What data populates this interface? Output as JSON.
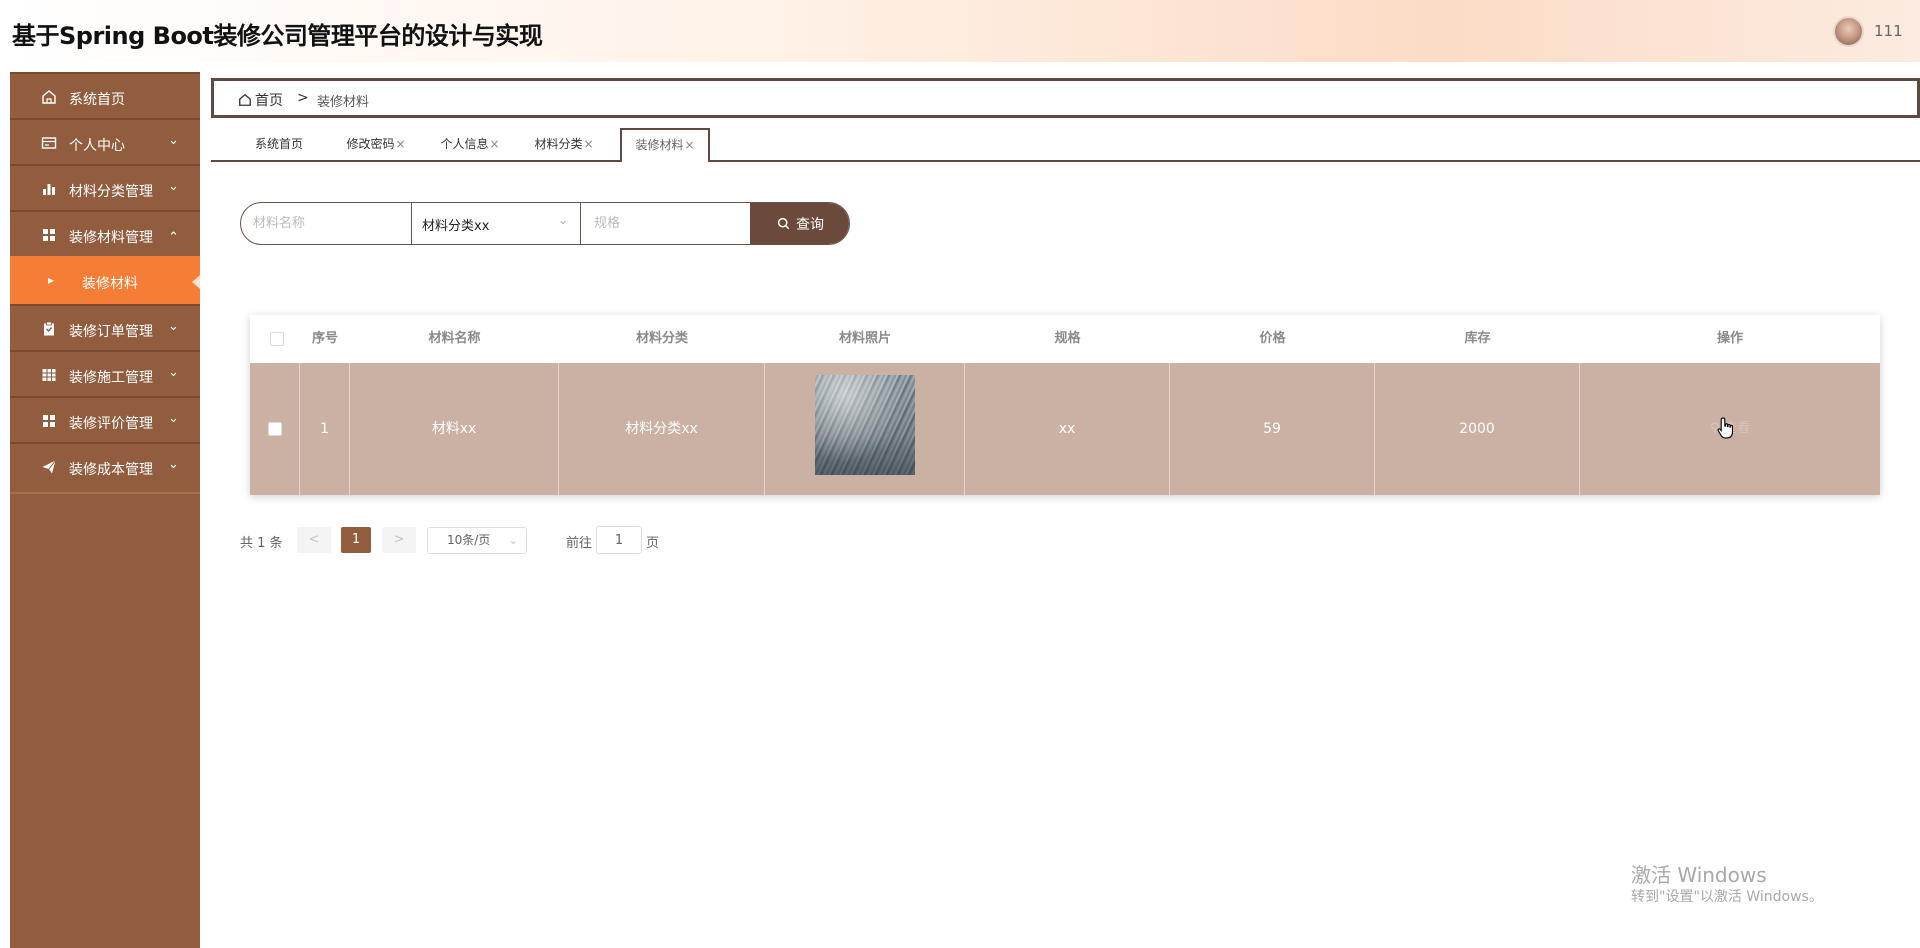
{
  "app": {
    "title": "基于Spring Boot装修公司管理平台的设计与实现",
    "username": "111"
  },
  "sidebar": {
    "items": [
      {
        "label": "系统首页",
        "icon": "home-icon"
      },
      {
        "label": "个人中心",
        "icon": "id-card-icon"
      },
      {
        "label": "材料分类管理",
        "icon": "bar-chart-icon"
      },
      {
        "label": "装修材料管理",
        "icon": "grid-icon",
        "expanded": true
      },
      {
        "label": "装修订单管理",
        "icon": "clipboard-icon"
      },
      {
        "label": "装修施工管理",
        "icon": "table-grid-icon"
      },
      {
        "label": "装修评价管理",
        "icon": "grid-icon"
      },
      {
        "label": "装修成本管理",
        "icon": "send-icon"
      }
    ],
    "submenu": {
      "label": "装修材料"
    }
  },
  "breadcrumb": {
    "home": "首页",
    "separator": ">",
    "current": "装修材料"
  },
  "tabs": [
    {
      "label": "系统首页",
      "closable": false
    },
    {
      "label": "修改密码",
      "closable": true
    },
    {
      "label": "个人信息",
      "closable": true
    },
    {
      "label": "材料分类",
      "closable": true
    },
    {
      "label": "装修材料",
      "closable": true,
      "active": true
    }
  ],
  "tab_close_glyph": "×",
  "search": {
    "name_placeholder": "材料名称",
    "category_value": "材料分类xx",
    "spec_placeholder": "规格",
    "button_label": "查询"
  },
  "table": {
    "columns": [
      "序号",
      "材料名称",
      "材料分类",
      "材料照片",
      "规格",
      "价格",
      "库存",
      "操作"
    ],
    "rows": [
      {
        "index": "1",
        "name": "材料xx",
        "category": "材料分类xx",
        "spec": "xx",
        "price": "59",
        "stock": "2000",
        "action": "查看"
      }
    ]
  },
  "pagination": {
    "total_text": "共 1 条",
    "prev": "<",
    "current_page": "1",
    "next": ">",
    "page_size": "10条/页",
    "goto_label": "前往",
    "goto_value": "1",
    "page_suffix": "页"
  },
  "watermark": {
    "title": "激活 Windows",
    "subtitle": "转到\"设置\"以激活 Windows。"
  },
  "colors": {
    "sidebar": "#925d3f",
    "submenu_active": "#f67d36",
    "accent_dark": "#6b4a3c",
    "row_selected": "#cbb0a4",
    "page_active": "#925d3f"
  }
}
